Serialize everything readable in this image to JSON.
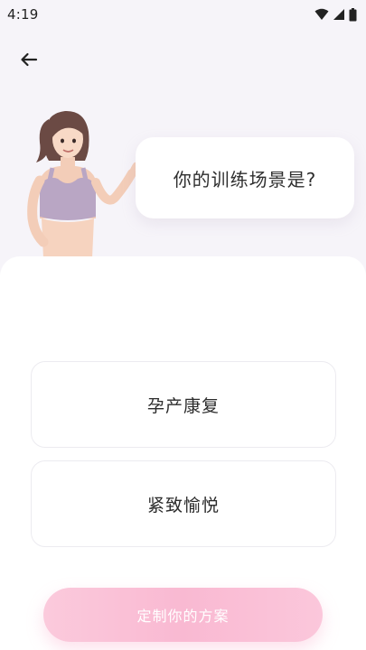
{
  "status_bar": {
    "time": "4:19",
    "icons": [
      "wifi-icon",
      "signal-icon",
      "battery-icon"
    ]
  },
  "header": {
    "back_icon": "arrow-left-icon"
  },
  "question": {
    "text": "你的训练场景是?"
  },
  "options": [
    {
      "label": "孕产康复"
    },
    {
      "label": "紧致愉悦"
    }
  ],
  "cta": {
    "label": "定制你的方案"
  },
  "colors": {
    "background": "#f6f4f9",
    "cta_pink": "#f9b9d2",
    "text_dark": "#2b2b2b"
  }
}
